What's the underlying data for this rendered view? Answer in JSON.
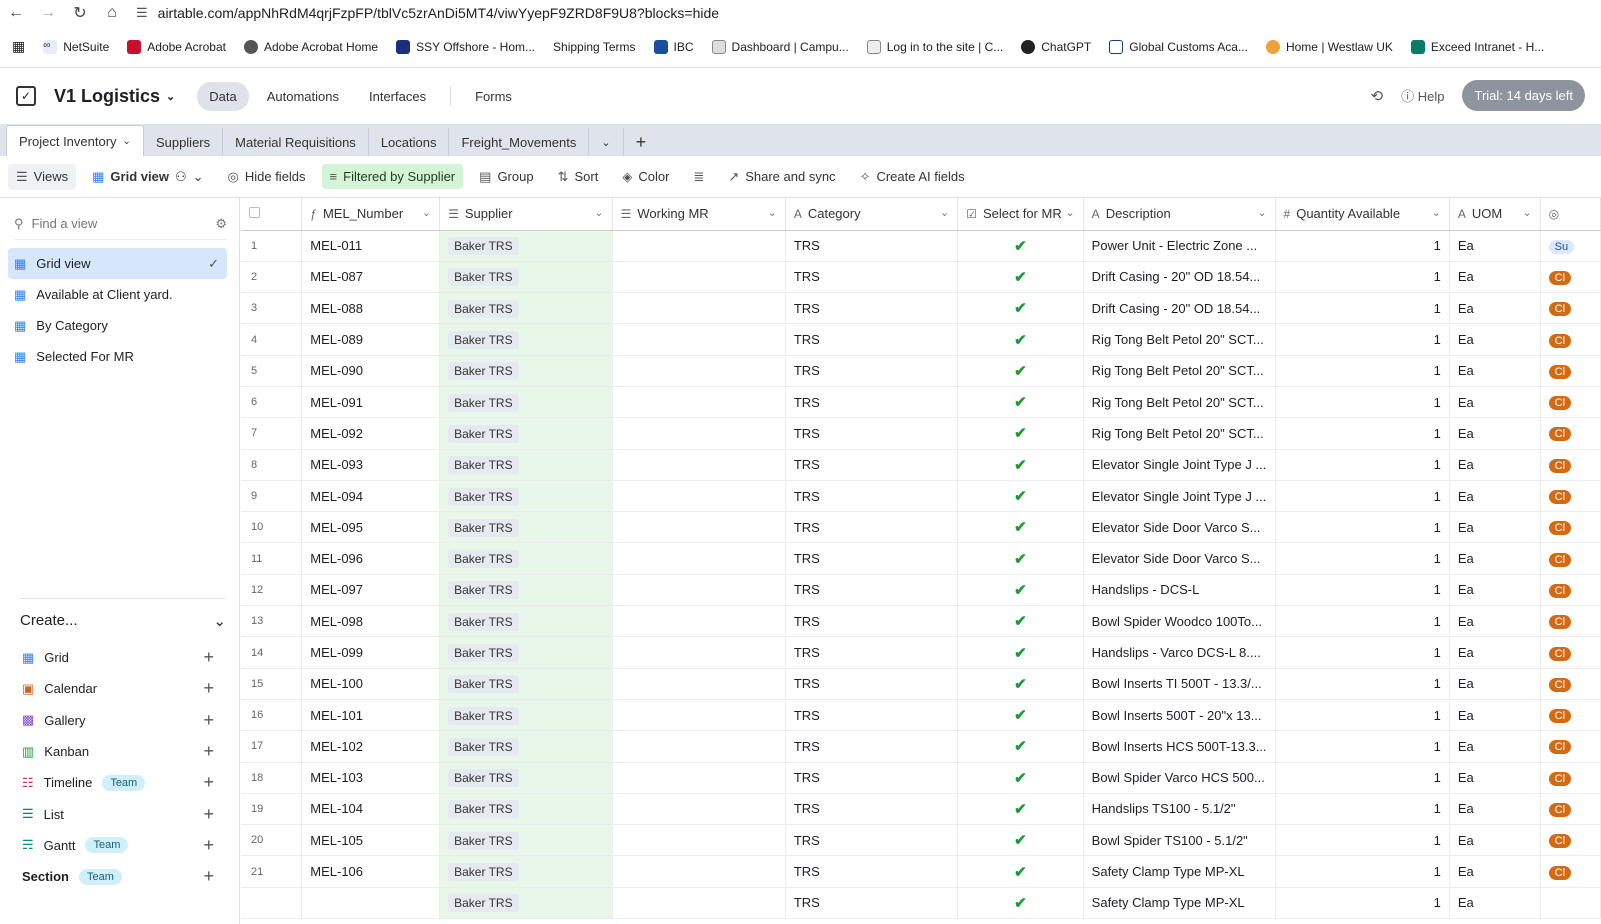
{
  "browser": {
    "url": "airtable.com/appNhRdM4qrjFzpFP/tblVc5zrAnDi5MT4/viwYyepF9ZRD8F9U8?blocks=hide",
    "bookmarks": [
      "NetSuite",
      "Adobe Acrobat",
      "Adobe Acrobat Home",
      "SSY Offshore - Hom...",
      "Shipping Terms",
      "IBC",
      "Dashboard | Campu...",
      "Log in to the site | C...",
      "ChatGPT",
      "Global Customs Aca...",
      "Home | Westlaw UK",
      "Exceed Intranet - H..."
    ]
  },
  "app": {
    "base_name": "V1 Logistics",
    "nav": [
      "Data",
      "Automations",
      "Interfaces",
      "Forms"
    ],
    "help": "Help",
    "trial": "Trial: 14 days left"
  },
  "tables": [
    "Project Inventory",
    "Suppliers",
    "Material Requisitions",
    "Locations",
    "Freight_Movements"
  ],
  "toolbar": {
    "views": "Views",
    "grid_view": "Grid view",
    "hide_fields": "Hide fields",
    "filter": "Filtered by Supplier",
    "group": "Group",
    "sort": "Sort",
    "color": "Color",
    "share": "Share and sync",
    "ai": "Create AI fields"
  },
  "sidebar": {
    "find_placeholder": "Find a view",
    "views": [
      "Grid view",
      "Available at Client yard.",
      "By Category",
      "Selected For MR"
    ],
    "create_title": "Create...",
    "create_items": [
      {
        "label": "Grid",
        "team": ""
      },
      {
        "label": "Calendar",
        "team": ""
      },
      {
        "label": "Gallery",
        "team": ""
      },
      {
        "label": "Kanban",
        "team": ""
      },
      {
        "label": "Timeline",
        "team": "Team"
      },
      {
        "label": "List",
        "team": ""
      },
      {
        "label": "Gantt",
        "team": "Team"
      },
      {
        "label": "Section",
        "team": "Team"
      }
    ]
  },
  "grid": {
    "columns": [
      "MEL_Number",
      "Supplier",
      "Working MR",
      "Category",
      "Select for MR",
      "Description",
      "Quantity Available",
      "UOM"
    ],
    "rows": [
      {
        "n": "1",
        "mel": "MEL-011",
        "desc": "Power Unit - Electric Zone ...",
        "stat": "Su"
      },
      {
        "n": "2",
        "mel": "MEL-087",
        "desc": "Drift Casing - 20\" OD 18.54...",
        "stat": "Cl"
      },
      {
        "n": "3",
        "mel": "MEL-088",
        "desc": "Drift Casing - 20\" OD 18.54...",
        "stat": "Cl"
      },
      {
        "n": "4",
        "mel": "MEL-089",
        "desc": "Rig Tong Belt Petol 20\" SCT...",
        "stat": "Cl"
      },
      {
        "n": "5",
        "mel": "MEL-090",
        "desc": "Rig Tong Belt Petol 20\" SCT...",
        "stat": "Cl"
      },
      {
        "n": "6",
        "mel": "MEL-091",
        "desc": "Rig Tong Belt Petol 20\" SCT...",
        "stat": "Cl"
      },
      {
        "n": "7",
        "mel": "MEL-092",
        "desc": "Rig Tong Belt Petol 20\" SCT...",
        "stat": "Cl"
      },
      {
        "n": "8",
        "mel": "MEL-093",
        "desc": "Elevator Single Joint Type J ...",
        "stat": "Cl"
      },
      {
        "n": "9",
        "mel": "MEL-094",
        "desc": "Elevator Single Joint Type J ...",
        "stat": "Cl"
      },
      {
        "n": "10",
        "mel": "MEL-095",
        "desc": "Elevator Side Door Varco S...",
        "stat": "Cl"
      },
      {
        "n": "11",
        "mel": "MEL-096",
        "desc": "Elevator Side Door Varco S...",
        "stat": "Cl"
      },
      {
        "n": "12",
        "mel": "MEL-097",
        "desc": "Handslips - DCS-L",
        "stat": "Cl"
      },
      {
        "n": "13",
        "mel": "MEL-098",
        "desc": "Bowl Spider Woodco 100To...",
        "stat": "Cl"
      },
      {
        "n": "14",
        "mel": "MEL-099",
        "desc": "Handslips - Varco DCS-L 8....",
        "stat": "Cl"
      },
      {
        "n": "15",
        "mel": "MEL-100",
        "desc": "Bowl Inserts TI 500T - 13.3/...",
        "stat": "Cl"
      },
      {
        "n": "16",
        "mel": "MEL-101",
        "desc": "Bowl Inserts 500T - 20\"x 13...",
        "stat": "Cl"
      },
      {
        "n": "17",
        "mel": "MEL-102",
        "desc": "Bowl Inserts HCS 500T-13.3...",
        "stat": "Cl"
      },
      {
        "n": "18",
        "mel": "MEL-103",
        "desc": "Bowl Spider Varco HCS 500...",
        "stat": "Cl"
      },
      {
        "n": "19",
        "mel": "MEL-104",
        "desc": "Handslips TS100 - 5.1/2\"",
        "stat": "Cl"
      },
      {
        "n": "20",
        "mel": "MEL-105",
        "desc": "Bowl Spider TS100 - 5.1/2\"",
        "stat": "Cl"
      },
      {
        "n": "21",
        "mel": "MEL-106",
        "desc": "Safety Clamp Type MP-XL",
        "stat": "Cl"
      },
      {
        "n": "",
        "mel": "",
        "desc": "Safety Clamp Type MP-XL",
        "stat": ""
      }
    ],
    "supplier": "Baker TRS",
    "category": "TRS",
    "qty": "1",
    "uom": "Ea",
    "check": "✔"
  }
}
